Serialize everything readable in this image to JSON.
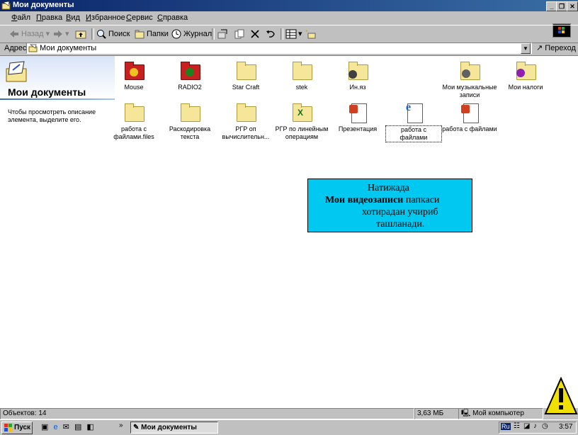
{
  "window": {
    "title": "Мои документы",
    "colors": {
      "titlebar": "#0a246a",
      "callout": "#00c8f0"
    }
  },
  "menu": {
    "items": [
      {
        "key": "Ф",
        "rest": "айл"
      },
      {
        "key": "П",
        "rest": "равка"
      },
      {
        "key": "В",
        "rest": "ид"
      },
      {
        "key": "И",
        "rest": "збранное"
      },
      {
        "key": "С",
        "rest": "ервис"
      },
      {
        "key": "С",
        "rest": "правка"
      }
    ]
  },
  "toolbar": {
    "back": "Назад",
    "search": "Поиск",
    "folders": "Папки",
    "history": "Журнал"
  },
  "address": {
    "label": "Адрес",
    "value": "Мои документы",
    "go": "Переход"
  },
  "left_pane": {
    "title": "Мои документы",
    "description": "Чтобы просмотреть описание элемента, выделите его."
  },
  "files": [
    {
      "name": "Mouse",
      "icon": "red-folder-icon"
    },
    {
      "name": "RADIO2",
      "icon": "red-folder-icon"
    },
    {
      "name": "Star Craft",
      "icon": "folder-icon"
    },
    {
      "name": "stek",
      "icon": "folder-icon"
    },
    {
      "name": "Ин.яз",
      "icon": "folder-icon"
    },
    {
      "name": "Мои музыкальные записи",
      "icon": "music-folder-icon"
    },
    {
      "name": "Мои налоги",
      "icon": "folder-icon"
    },
    {
      "name": "работа с файлами.files",
      "icon": "folder-icon"
    },
    {
      "name": "Раскодировка текста",
      "icon": "folder-icon"
    },
    {
      "name": "РГР оп вычислительн...",
      "icon": "folder-icon"
    },
    {
      "name": "РГР по линейным операциям",
      "icon": "excel-doc-icon"
    },
    {
      "name": "Презентация",
      "icon": "powerpoint-doc-icon"
    },
    {
      "name": "работа с файлами",
      "icon": "ie-doc-icon"
    },
    {
      "name": "работа с файлами",
      "icon": "powerpoint-doc-icon"
    }
  ],
  "callout": {
    "line1": "Натижада",
    "line2_bold": "Мои видеозаписи",
    "line2_rest": "папкаси",
    "line3": "хотирадан учириб",
    "line4": "ташланади."
  },
  "status": {
    "objects": "Объектов: 14",
    "size": "3,63 МБ",
    "location": "Мой компьютер"
  },
  "taskbar": {
    "start": "Пуск",
    "task": "Мои документы",
    "lang": "Ru",
    "time": "3:57"
  }
}
